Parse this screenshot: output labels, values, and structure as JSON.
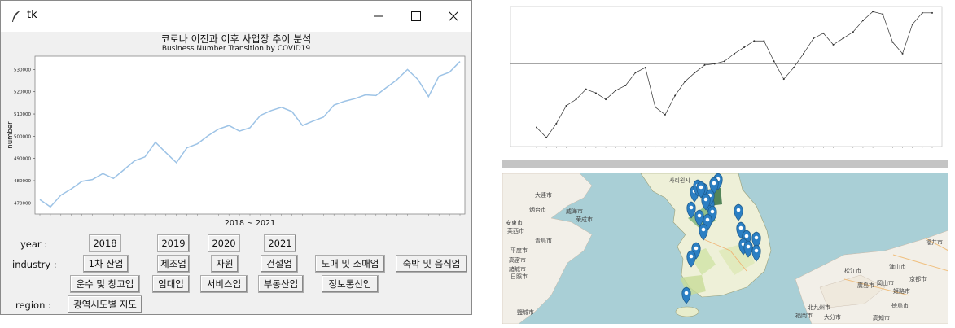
{
  "window": {
    "title": "tk",
    "heading": "코로나 이전과 이후 사업장 추이 분석",
    "controls": {
      "minimize": "minimize-icon",
      "maximize": "maximize-icon",
      "close": "close-icon"
    }
  },
  "main_chart": {
    "title": "Business Number Transition by COVID19",
    "xlabel": "2018 ~ 2021",
    "ylabel": "number",
    "yticks": [
      "470000",
      "480000",
      "490000",
      "500000",
      "510000",
      "520000",
      "530000"
    ]
  },
  "controls": {
    "year_label": "year :",
    "years": [
      "2018",
      "2019",
      "2020",
      "2021"
    ],
    "industry_label": "industry :",
    "industries_row1": [
      "1차 산업",
      "제조업",
      "자원",
      "건설업",
      "도매 및 소매업",
      "숙박 및 음식업"
    ],
    "industries_row2": [
      "운수 및 창고업",
      "임대업",
      "서비스업",
      "부동산업",
      "정보통신업"
    ],
    "region_label": "region :",
    "region_button": "광역시도별 지도"
  },
  "chart_data": [
    {
      "type": "line",
      "title": "Business Number Transition by COVID19",
      "xlabel": "2018 ~ 2021",
      "ylabel": "number",
      "ylim": [
        465000,
        536000
      ],
      "series": [
        {
          "values": [
            471500,
            468200,
            473500,
            476300,
            479700,
            480500,
            483200,
            481000,
            484900,
            488900,
            490700,
            497300,
            492600,
            488100,
            494800,
            496600,
            500200,
            503200,
            504800,
            502300,
            503800,
            509400,
            511500,
            513000,
            511100,
            504800,
            506800,
            508600,
            514000,
            515700,
            516900,
            518600,
            518300,
            521900,
            525400,
            530000,
            525500,
            517800,
            527000,
            528800,
            533600
          ]
        }
      ],
      "line_color": "#9dc3e6"
    },
    {
      "type": "line",
      "title": "",
      "series": [
        {
          "values": [
            180,
            172,
            183,
            197,
            202,
            210,
            207,
            202,
            209,
            213,
            223,
            227,
            196,
            190,
            205,
            216,
            223,
            229,
            230,
            232,
            238,
            243,
            248,
            248,
            232,
            218,
            227,
            238,
            250,
            254,
            245,
            250,
            255,
            264,
            271,
            269,
            247,
            238,
            261,
            270,
            270
          ]
        }
      ],
      "hline": 230,
      "line_color": "#333333"
    }
  ],
  "map": {
    "labels": {
      "onl": "大連市",
      "c2": "烟台市",
      "c3": "威海市",
      "c4": "荣成市",
      "c5": "青島市",
      "c6": "安東市",
      "c7": "莱西市",
      "c8": "平度市",
      "c9": "高密市",
      "c10": "日照市",
      "c11": "諸城市",
      "c12": "鹽城市",
      "c13": "廣島市",
      "c14": "岡山市",
      "c15": "姫路市",
      "c16": "京都市",
      "c17": "津山市",
      "c18": "福井市",
      "c19": "福岡市",
      "c20": "北九州市",
      "c21": "大分市",
      "c22": "高知市",
      "c23": "徳島市",
      "c24": "松江市",
      "c25": "사리원시"
    },
    "marker_count": 24,
    "accent": "#2b7fc3"
  }
}
